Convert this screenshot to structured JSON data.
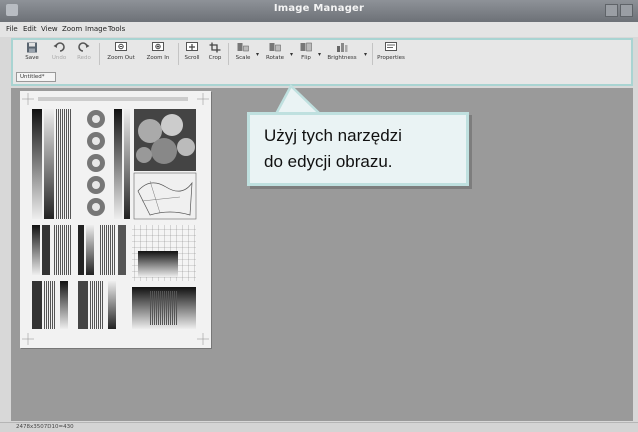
{
  "window": {
    "title": "Image Manager"
  },
  "menu": [
    "File",
    "Edit",
    "View",
    "Zoom",
    "Image",
    "Tools"
  ],
  "toolbar": {
    "save": "Save",
    "undo": "Undo",
    "redo": "Redo",
    "zoom_out": "Zoom Out",
    "zoom_in": "Zoom In",
    "scroll": "Scroll",
    "crop": "Crop",
    "scale": "Scale",
    "rotate": "Rotate",
    "flip": "Flip",
    "brightness": "Brightness",
    "properties": "Properties"
  },
  "document_tab": "Untitled*",
  "statusbar": {
    "text": "2478x3507D10=430"
  },
  "callout": {
    "line1": "Użyj tych narzędzi",
    "line2": "do edycji obrazu."
  },
  "colors": {
    "highlight": "#a9d4d2",
    "callout_bg": "#eaf3f4",
    "workspace": "#9a9a9a"
  },
  "icons": [
    "save-icon",
    "undo-icon",
    "redo-icon",
    "zoom-out-icon",
    "zoom-in-icon",
    "scroll-icon",
    "crop-icon",
    "scale-icon",
    "rotate-icon",
    "flip-icon",
    "brightness-icon",
    "properties-icon"
  ]
}
